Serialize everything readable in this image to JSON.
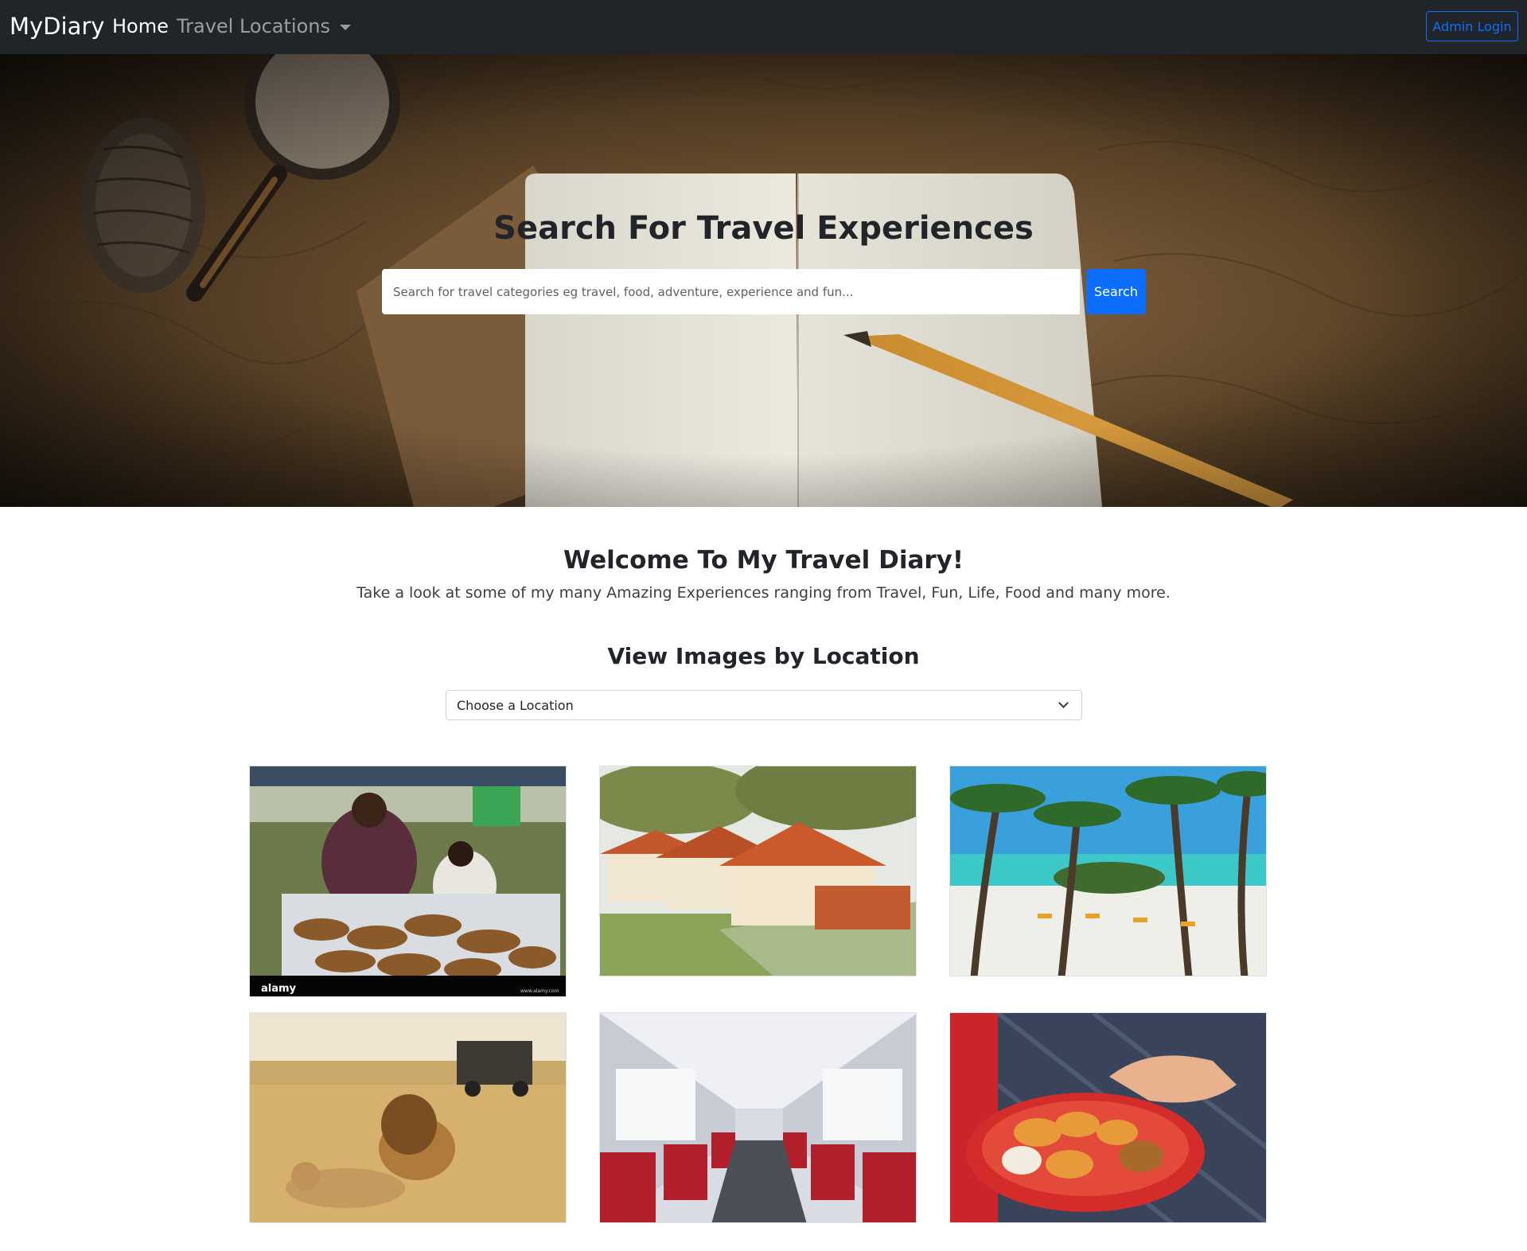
{
  "navbar": {
    "brand": "MyDiary",
    "home_label": "Home",
    "locations_label": "Travel Locations",
    "admin_label": "Admin Login"
  },
  "hero": {
    "title": "Search For Travel Experiences",
    "search_placeholder": "Search for travel categories eg travel, food, adventure, experience and fun...",
    "search_button": "Search"
  },
  "welcome": {
    "title": "Welcome To My Travel Diary!",
    "subtitle": "Take a look at some of my many Amazing Experiences ranging from Travel, Fun, Life, Food and many more."
  },
  "location_filter": {
    "title": "View Images by Location",
    "selected": "Choose a Location"
  },
  "colors": {
    "navbar_bg": "#212529",
    "primary": "#0d6efd"
  },
  "gallery": {
    "watermark_brand": "alamy",
    "watermark_site": "www.alamy.com"
  }
}
